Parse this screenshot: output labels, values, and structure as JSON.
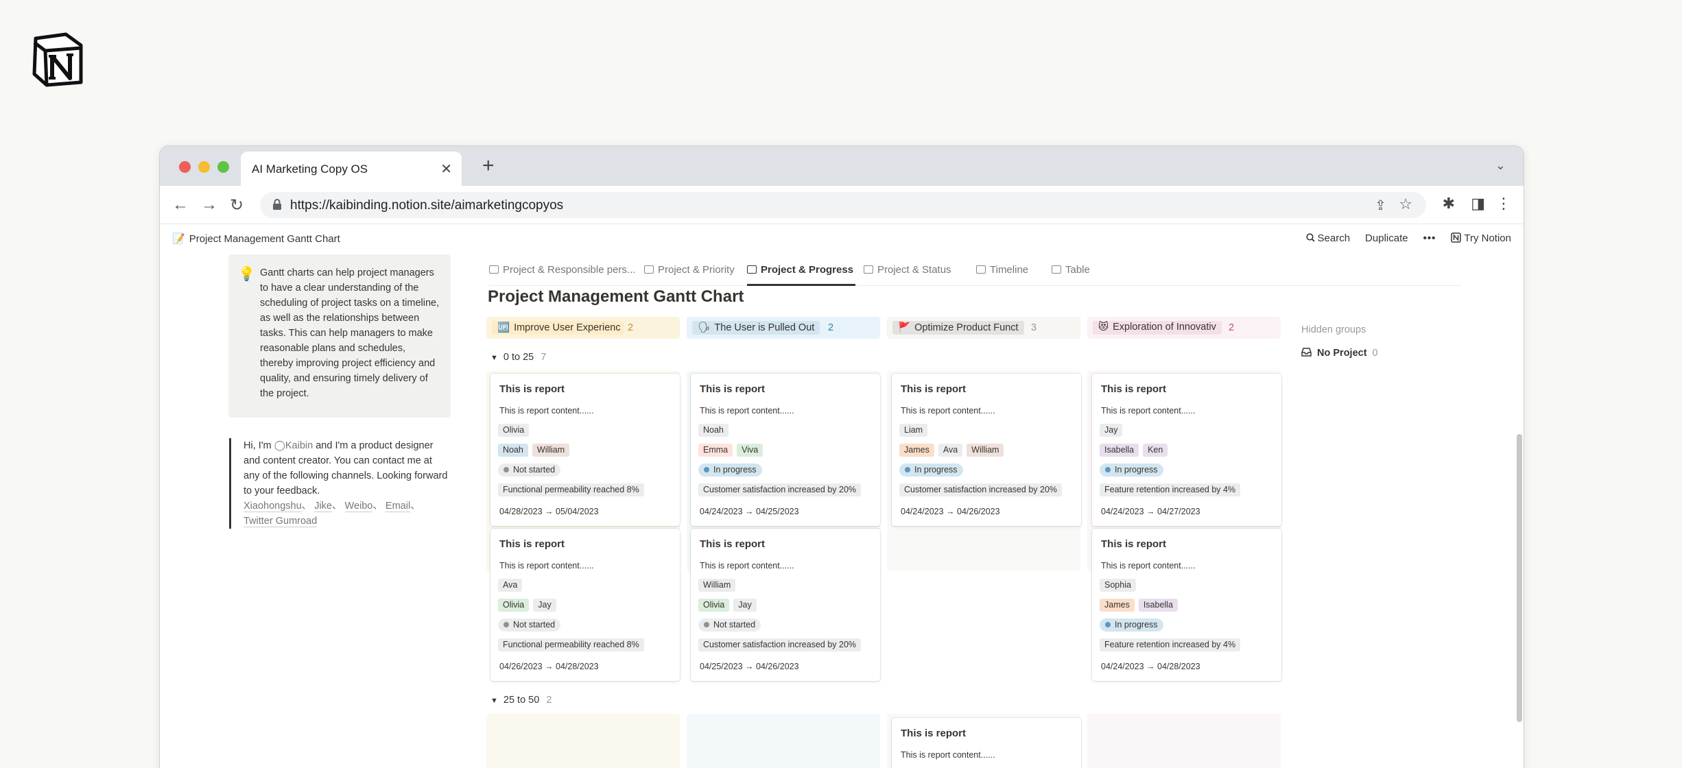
{
  "browser": {
    "tab_title": "AI Marketing Copy OS",
    "tab_close": "✕",
    "new_tab": "+",
    "tab_menu": "⌄",
    "back": "←",
    "forward": "→",
    "reload": "↻",
    "url": "https://kaibinding.notion.site/aimarketingcopyos",
    "share": "⇪",
    "star": "☆",
    "extensions": "✱",
    "sidebar": "◨",
    "menu": "⋮"
  },
  "notion": {
    "page_title": "Project Management Gantt Chart",
    "page_icon": "📝",
    "search_label": "Search",
    "duplicate_label": "Duplicate",
    "more_label": "•••",
    "try_notion_label": "Try Notion"
  },
  "callout": {
    "icon": "💡",
    "text": "Gantt charts can help project managers to have a clear understanding of the scheduling of project tasks on a timeline, as well as the relationships between tasks. This can help managers to make reasonable plans and schedules, thereby improving project efficiency and quality, and ensuring timely delivery of the project."
  },
  "quote": {
    "text_before": "Hi, I'm ",
    "mention": "◯Kaibin",
    "text_after": " and I'm a product designer and content creator. You can contact me at any of the following channels. Looking forward to your feedback.",
    "links": [
      "Xiaohongshu",
      "Jike",
      "Weibo",
      "Email",
      "Twitter Gumroad"
    ],
    "separator": "、"
  },
  "views": [
    {
      "label": "Project & Responsible pers...",
      "active": false
    },
    {
      "label": "Project & Priority",
      "active": false
    },
    {
      "label": "Project & Progress",
      "active": true
    },
    {
      "label": "Project & Status",
      "active": false
    },
    {
      "label": "Timeline",
      "active": false
    },
    {
      "label": "Table",
      "active": false
    }
  ],
  "database_title": "Project Management Gantt Chart",
  "groups": [
    {
      "icon": "🆙",
      "label": "Improve User Experienc",
      "count": "2",
      "bg": "#fbf3db",
      "pill": "#fdecc8",
      "count_color": "#cb912f",
      "col_bg": "#fbf8ef"
    },
    {
      "icon": "🗣",
      "label": "The User is Pulled Out",
      "count": "2",
      "bg": "#e7f3f8",
      "pill": "#d3e5ef",
      "count_color": "#337ea9",
      "col_bg": "#f3f8fb"
    },
    {
      "icon": "🚩",
      "label": "Optimize Product Funct",
      "count": "3",
      "bg": "#f7f6f3",
      "pill": "#e3e2e0",
      "count_color": "#9b9a97",
      "col_bg": "#f9f9f8"
    },
    {
      "icon": "😻",
      "label": "Exploration of Innovativ",
      "count": "2",
      "bg": "#fbf2f5",
      "pill": "#f5e0e9",
      "count_color": "#c14c8a",
      "col_bg": "#fbf6f8"
    }
  ],
  "hidden_groups_label": "Hidden groups",
  "no_project": {
    "icon": "🗂",
    "label": "No Project",
    "count": "0"
  },
  "subgroups": [
    {
      "toggle": "▼",
      "label": "0 to 25",
      "count": "7"
    },
    {
      "toggle": "▼",
      "label": "25 to 50",
      "count": "2"
    }
  ],
  "cards": [
    {
      "title": "This is report",
      "content": "This is report content......",
      "owner": "Olivia",
      "members": [
        {
          "name": "Noah",
          "color": "blue"
        },
        {
          "name": "William",
          "color": "brown"
        }
      ],
      "status": "Not started",
      "goal": "Functional permeability reached 8%",
      "dates": "04/28/2023 → 05/04/2023"
    },
    {
      "title": "This is report",
      "content": "This is report content......",
      "owner": "Noah",
      "members": [
        {
          "name": "Emma",
          "color": "red"
        },
        {
          "name": "Viva",
          "color": "green"
        }
      ],
      "status": "In progress",
      "goal": "Customer satisfaction increased by 20%",
      "dates": "04/24/2023 → 04/25/2023"
    },
    {
      "title": "This is report",
      "content": "This is report content......",
      "owner": "Liam",
      "members": [
        {
          "name": "James",
          "color": "orange"
        },
        {
          "name": "Ava",
          "color": "gray"
        },
        {
          "name": "William",
          "color": "brown"
        }
      ],
      "status": "In progress",
      "goal": "Customer satisfaction increased by 20%",
      "dates": "04/24/2023 → 04/26/2023"
    },
    {
      "title": "This is report",
      "content": "This is report content......",
      "owner": "Jay",
      "members": [
        {
          "name": "Isabella",
          "color": "purple"
        },
        {
          "name": "Ken",
          "color": "purple"
        }
      ],
      "status": "In progress",
      "goal": "Feature retention increased by 4%",
      "dates": "04/24/2023 → 04/27/2023"
    },
    {
      "title": "This is report",
      "content": "This is report content......",
      "owner": "Ava",
      "members": [
        {
          "name": "Olivia",
          "color": "green"
        },
        {
          "name": "Jay",
          "color": "gray"
        }
      ],
      "status": "Not started",
      "goal": "Functional permeability reached 8%",
      "dates": "04/26/2023 → 04/28/2023"
    },
    {
      "title": "This is report",
      "content": "This is report content......",
      "owner": "William",
      "members": [
        {
          "name": "Olivia",
          "color": "green"
        },
        {
          "name": "Jay",
          "color": "gray"
        }
      ],
      "status": "Not started",
      "goal": "Customer satisfaction increased by 20%",
      "dates": "04/25/2023 → 04/26/2023"
    },
    {
      "title": "This is report",
      "content": "This is report content......",
      "owner": "Sophia",
      "members": [
        {
          "name": "James",
          "color": "orange"
        },
        {
          "name": "Isabella",
          "color": "purple"
        }
      ],
      "status": "In progress",
      "goal": "Feature retention increased by 4%",
      "dates": "04/24/2023 → 04/28/2023"
    },
    {
      "title": "This is report",
      "content": "This is report content......"
    }
  ]
}
